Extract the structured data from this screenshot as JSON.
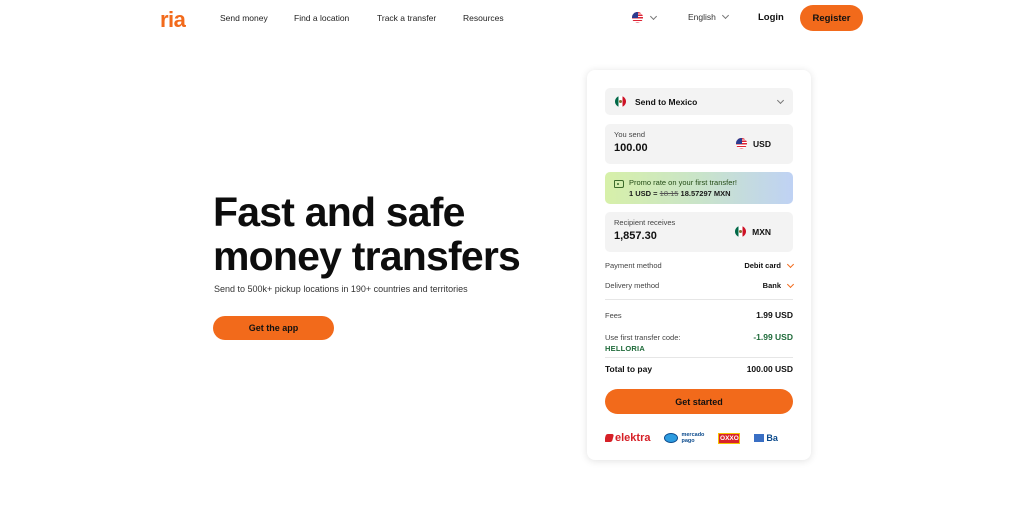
{
  "brand": {
    "logo_text": "ria",
    "accent_color": "#f26a1b"
  },
  "nav": {
    "links": [
      "Send money",
      "Find a location",
      "Track a transfer",
      "Resources"
    ],
    "country_icon": "us-flag-icon",
    "language": "English",
    "login": "Login",
    "register": "Register"
  },
  "hero": {
    "title_line1": "Fast and safe",
    "title_line2": "money transfers",
    "subtitle": "Send to 500k+ pickup locations in 190+ countries and territories",
    "cta": "Get the app"
  },
  "calculator": {
    "destination": "Send to Mexico",
    "you_send": {
      "caption": "You send",
      "amount": "100.00",
      "currency": "USD"
    },
    "promo": {
      "headline": "Promo rate on your first transfer!",
      "rate_prefix": "1 USD =",
      "old_rate": "18.15",
      "new_rate": "18.57297 MXN"
    },
    "recipient": {
      "caption": "Recipient receives",
      "amount": "1,857.30",
      "currency": "MXN"
    },
    "payment_method": {
      "label": "Payment method",
      "value": "Debit card"
    },
    "delivery_method": {
      "label": "Delivery method",
      "value": "Bank"
    },
    "fees": {
      "label": "Fees",
      "value": "1.99 USD"
    },
    "first_code": {
      "label": "Use first transfer code:",
      "code": "HELLORIA",
      "value": "-1.99 USD"
    },
    "total": {
      "label": "Total to pay",
      "value": "100.00 USD"
    },
    "cta": "Get started",
    "partners": {
      "elektra": "elektra",
      "mercado_pago_line1": "mercado",
      "mercado_pago_line2": "pago",
      "oxxo": "OXXO",
      "bank_partial": "Ba"
    }
  }
}
